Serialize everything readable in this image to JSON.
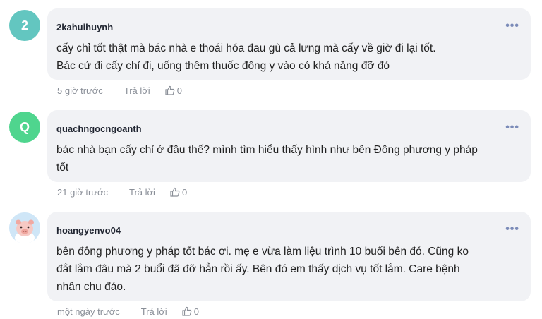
{
  "comments": [
    {
      "avatar_letter": "2",
      "avatar_color": "#63c6c0",
      "username": "2kahuihuynh",
      "text_lines": [
        "cấy chỉ tốt thật mà bác nhà e thoái hóa đau gù cả lưng mà cấy về giờ đi lại tốt.",
        "Bác cứ đi cấy chỉ đi, uống thêm thuốc đông y vào có khả năng đỡ đó"
      ],
      "time": "5 giờ trước",
      "reply_label": "Trả lời",
      "likes": "0",
      "more_label": "•••"
    },
    {
      "avatar_letter": "Q",
      "avatar_color": "#4fd58e",
      "username": "quachngocngoanth",
      "text_lines": [
        "bác nhà bạn cấy chỉ ở đâu thế? mình tìm hiểu thấy hình như bên Đông phương y pháp",
        "tốt"
      ],
      "time": "21 giờ trước",
      "reply_label": "Trả lời",
      "likes": "0",
      "more_label": "•••"
    },
    {
      "avatar_icon": "pig-avatar-icon",
      "avatar_color": "#cfe6f7",
      "username": "hoangyenvo04",
      "text_lines": [
        "bên đông phương y pháp tốt bác ơi. mẹ e vừa làm liệu trình 10 buổi bên đó. Cũng ko",
        "đắt lắm đâu mà 2 buổi đã đỡ hẳn rồi ấy. Bên đó em thấy dịch vụ tốt lắm. Care bệnh",
        "nhân chu đáo."
      ],
      "time": "một ngày trước",
      "reply_label": "Trả lời",
      "likes": "0",
      "more_label": "•••"
    }
  ]
}
